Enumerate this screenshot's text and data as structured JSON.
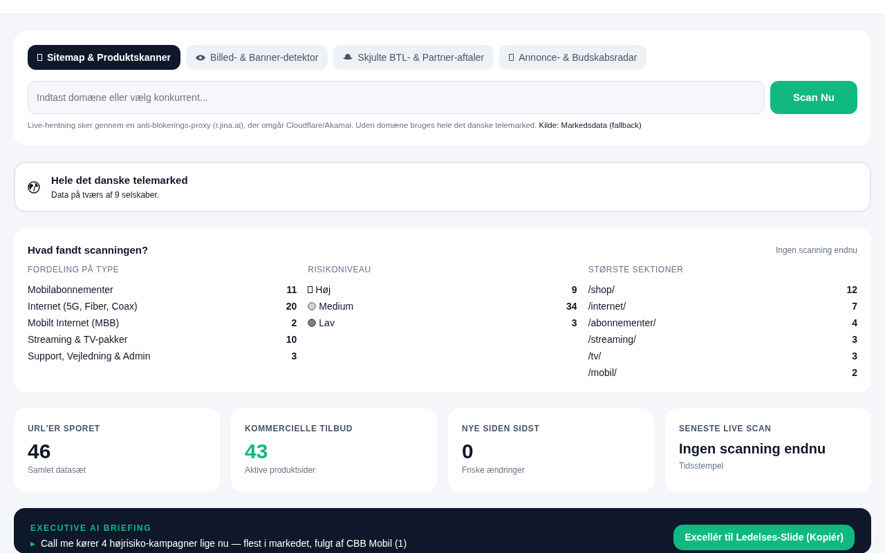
{
  "tabs": [
    {
      "label": "Sitemap & Produktskanner",
      "kind": "box",
      "selected": true
    },
    {
      "label": "Billed- & Banner-detektor",
      "kind": "eye",
      "selected": false
    },
    {
      "label": "Skjulte BTL- & Partner-aftaler",
      "kind": "hat",
      "selected": false
    },
    {
      "label": "Annonce- & Budskabsradar",
      "kind": "box",
      "selected": false
    }
  ],
  "search": {
    "placeholder": "Indtast domæne eller vælg konkurrent...",
    "button": "Scan Nu"
  },
  "note": {
    "text": "Live-hentning sker gennem en anti-blokerings-proxy (r.jina.ai), der omgår Cloudflare/Akamai. Uden domæne bruges hele det danske telemarked.",
    "source": "Kilde: Markedsdata (fallback)"
  },
  "scope": {
    "title": "Hele det danske telemarked",
    "subtitle": "Data på tværs af 9 selskaber."
  },
  "findings": {
    "title": "Hvad fandt scanningen?",
    "status": "Ingen scanning endnu",
    "columns": [
      {
        "heading": "FORDELING PÅ TYPE",
        "rows": [
          {
            "label": "Mobilabonnementer",
            "value": "11"
          },
          {
            "label": "Internet (5G, Fiber, Coax)",
            "value": "20"
          },
          {
            "label": "Mobilt Internet (MBB)",
            "value": "2"
          },
          {
            "label": "Streaming & TV-pakker",
            "value": "10"
          },
          {
            "label": "Support, Vejledning & Admin",
            "value": "3"
          }
        ]
      },
      {
        "heading": "RISIKONIVEAU",
        "rows": [
          {
            "label": "Høj",
            "value": "9",
            "kind": "box"
          },
          {
            "label": "Medium",
            "value": "34",
            "kind": "light"
          },
          {
            "label": "Lav",
            "value": "3",
            "kind": "dark"
          }
        ]
      },
      {
        "heading": "STØRSTE SEKTIONER",
        "rows": [
          {
            "label": "/shop/",
            "value": "12"
          },
          {
            "label": "/internet/",
            "value": "7"
          },
          {
            "label": "/abonnementer/",
            "value": "4"
          },
          {
            "label": "/streaming/",
            "value": "3"
          },
          {
            "label": "/tv/",
            "value": "3"
          },
          {
            "label": "/mobil/",
            "value": "2"
          }
        ]
      }
    ]
  },
  "stats": [
    {
      "label": "URL'ER SPORET",
      "value": "46",
      "caption": "Samlet datasæt",
      "kind": "number",
      "highlight": false
    },
    {
      "label": "KOMMERCIELLE TILBUD",
      "value": "43",
      "caption": "Aktive produktsider",
      "kind": "number",
      "highlight": true
    },
    {
      "label": "NYE SIDEN SIDST",
      "value": "0",
      "caption": "Friske ændringer",
      "kind": "number",
      "highlight": false
    },
    {
      "label": "SENESTE LIVE SCAN",
      "value": "Ingen scanning endnu",
      "caption": "Tidsstempel",
      "kind": "text",
      "highlight": false
    }
  ],
  "briefing": {
    "title": "EXECUTIVE AI BRIEFING",
    "button": "Excellér til Ledelses-Slide (Kopiér)",
    "items": [
      {
        "bullet": "▸",
        "text": "Call me kører 4 højrisiko-kampagner lige nu — flest i markedet, fulgt af CBB Mobil (1)"
      }
    ]
  }
}
